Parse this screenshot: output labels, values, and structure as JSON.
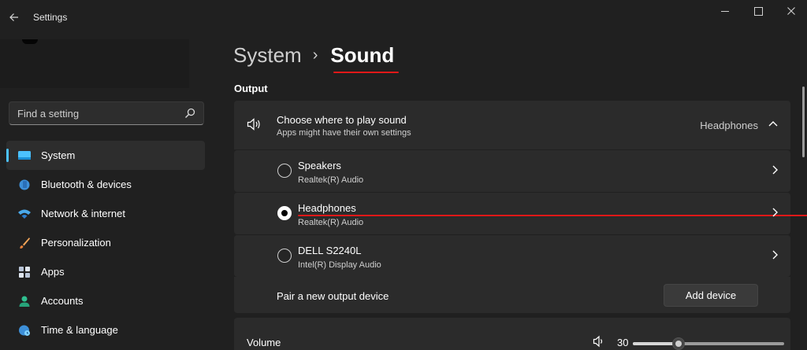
{
  "window": {
    "title": "Settings"
  },
  "search": {
    "placeholder": "Find a setting"
  },
  "sidebar": {
    "items": [
      {
        "label": "System",
        "icon": "monitor-icon",
        "active": true
      },
      {
        "label": "Bluetooth & devices",
        "icon": "bluetooth-icon"
      },
      {
        "label": "Network & internet",
        "icon": "wifi-icon"
      },
      {
        "label": "Personalization",
        "icon": "brush-icon"
      },
      {
        "label": "Apps",
        "icon": "apps-icon"
      },
      {
        "label": "Accounts",
        "icon": "person-icon"
      },
      {
        "label": "Time & language",
        "icon": "globe-clock-icon"
      }
    ]
  },
  "breadcrumb": {
    "parent": "System",
    "separator": "›",
    "current": "Sound"
  },
  "output": {
    "section_title": "Output",
    "choose": {
      "title": "Choose where to play sound",
      "subtitle": "Apps might have their own settings",
      "selected": "Headphones"
    },
    "devices": [
      {
        "name": "Speakers",
        "driver": "Realtek(R) Audio",
        "selected": false
      },
      {
        "name": "Headphones",
        "driver": "Realtek(R) Audio",
        "selected": true
      },
      {
        "name": "DELL S2240L",
        "driver": "Intel(R) Display Audio",
        "selected": false
      }
    ],
    "pair": {
      "label": "Pair a new output device",
      "button": "Add device"
    },
    "volume": {
      "label": "Volume",
      "value": "30",
      "level": 0.3
    }
  },
  "colors": {
    "accent": "#4cc2ff",
    "annotation_red": "#e01818",
    "background": "#202020",
    "card": "#2b2b2b"
  }
}
